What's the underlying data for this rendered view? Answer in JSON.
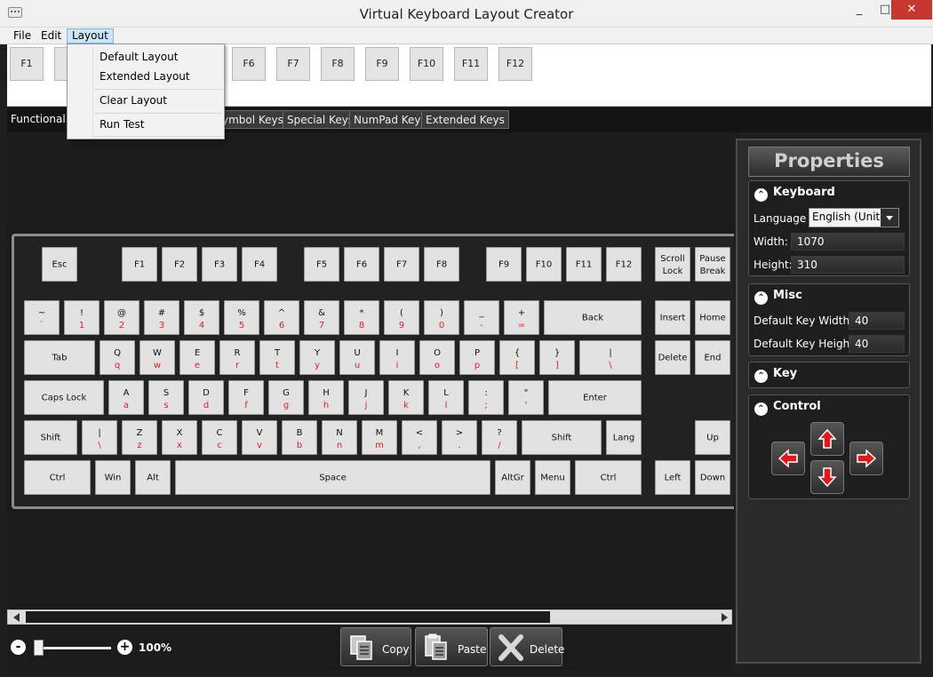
{
  "window": {
    "title": "Virtual Keyboard Layout Creator",
    "min": "_",
    "max": "□",
    "close": "✕"
  },
  "menubar": [
    "File",
    "Edit",
    "Layout"
  ],
  "dropdown": [
    "Default Layout",
    "Extended Layout",
    "Clear Layout",
    "Run Test"
  ],
  "fkey_strip": [
    "F1",
    "F6",
    "F7",
    "F8",
    "F9",
    "F10",
    "F11",
    "F12"
  ],
  "tabs": [
    "Functional K",
    "ymbol Keys",
    "Special Keys",
    "NumPad Keys",
    "Extended Keys"
  ],
  "keyboard": {
    "row1": [
      "Esc",
      "F1",
      "F2",
      "F3",
      "F4",
      "F5",
      "F6",
      "F7",
      "F8",
      "F9",
      "F10",
      "F11",
      "F12"
    ],
    "scroll_lock": [
      "Scroll",
      "Lock"
    ],
    "pause_break": [
      "Pause",
      "Break"
    ],
    "row2": [
      [
        "~",
        "`"
      ],
      [
        "!",
        "1"
      ],
      [
        "@",
        "2"
      ],
      [
        "#",
        "3"
      ],
      [
        "$",
        "4"
      ],
      [
        "%",
        "5"
      ],
      [
        "^",
        "6"
      ],
      [
        "&",
        "7"
      ],
      [
        "*",
        "8"
      ],
      [
        "(",
        "9"
      ],
      [
        ")",
        "0"
      ],
      [
        "_",
        "-"
      ],
      [
        "+",
        "="
      ]
    ],
    "back": "Back",
    "insert": "Insert",
    "home": "Home",
    "tab": "Tab",
    "row3": [
      [
        "Q",
        "q"
      ],
      [
        "W",
        "w"
      ],
      [
        "E",
        "e"
      ],
      [
        "R",
        "r"
      ],
      [
        "T",
        "t"
      ],
      [
        "Y",
        "y"
      ],
      [
        "U",
        "u"
      ],
      [
        "I",
        "i"
      ],
      [
        "O",
        "o"
      ],
      [
        "P",
        "p"
      ],
      [
        "{",
        "["
      ],
      [
        "}",
        "]"
      ],
      [
        "|",
        "\\"
      ]
    ],
    "delete": "Delete",
    "end": "End",
    "caps": "Caps Lock",
    "row4": [
      [
        "A",
        "a"
      ],
      [
        "S",
        "s"
      ],
      [
        "D",
        "d"
      ],
      [
        "F",
        "f"
      ],
      [
        "G",
        "g"
      ],
      [
        "H",
        "h"
      ],
      [
        "J",
        "j"
      ],
      [
        "K",
        "k"
      ],
      [
        "L",
        "l"
      ],
      [
        ":",
        ";"
      ],
      [
        "\"",
        "'"
      ]
    ],
    "enter": "Enter",
    "shift": "Shift",
    "row5": [
      [
        "|",
        "\\"
      ],
      [
        "Z",
        "z"
      ],
      [
        "X",
        "x"
      ],
      [
        "C",
        "c"
      ],
      [
        "V",
        "v"
      ],
      [
        "B",
        "b"
      ],
      [
        "N",
        "n"
      ],
      [
        "M",
        "m"
      ],
      [
        "<",
        ","
      ],
      [
        ">",
        "."
      ],
      [
        "?",
        "/"
      ]
    ],
    "shift_r": "Shift",
    "lang": "Lang",
    "up": "Up",
    "row6": [
      "Ctrl",
      "Win",
      "Alt",
      "Space",
      "AltGr",
      "Menu",
      "Ctrl"
    ],
    "left": "Left",
    "down": "Down"
  },
  "bottom": {
    "zoom": "100%",
    "minus": "-",
    "plus": "+",
    "zoom_value": 100,
    "copy": "Copy",
    "paste": "Paste",
    "delete": "Delete"
  },
  "properties": {
    "header": "Properties",
    "keyboard_section": "Keyboard",
    "language_label": "Language",
    "language_value": "English (United",
    "width_label": "Width:",
    "width_value": "1070",
    "height_label": "Height:",
    "height_value": "310",
    "misc_section": "Misc",
    "key_width_label": "Default Key Width:",
    "key_width_value": "40",
    "key_height_label": "Default Key Height:",
    "key_height_value": "40",
    "key_section": "Key",
    "control_section": "Control"
  },
  "colors": {
    "accent_red": "#e02020",
    "menu_highlight": "#cde6f7",
    "close_button": "#c7372f"
  }
}
